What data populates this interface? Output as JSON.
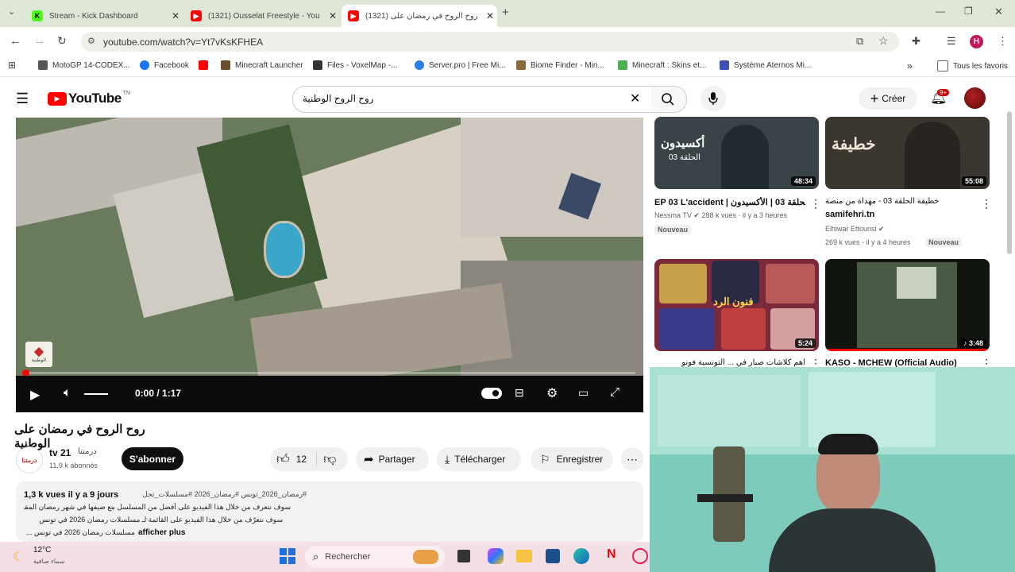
{
  "browser": {
    "tabs": [
      {
        "title": "Stream - Kick Dashboard",
        "favicon": "kick",
        "color": "#53fc18"
      },
      {
        "title": "(1321) Ousselat Freestyle - You",
        "favicon": "youtube",
        "color": "#ff0000"
      },
      {
        "title": "(1321) روح الروح في رمضان على",
        "favicon": "youtube",
        "color": "#ff0000"
      }
    ],
    "url": "youtube.com/watch?v=Yt7vKsKFHEA",
    "profile_initial": "H",
    "bookmarks": [
      "MotoGP 14-CODEX...",
      "Facebook",
      "",
      "Minecraft Launcher",
      "Files - VoxelMap -...",
      "Server.pro | Free Mi...",
      "Biome Finder - Min...",
      "Minecraft : Skins et...",
      "Système Aternos Mi..."
    ],
    "all_bookmarks": "Tous les favoris",
    "more": "»"
  },
  "youtube": {
    "logo": "YouTube",
    "logo_sup": "TN",
    "search_value": "روح الروح الوطنية",
    "create_label": "Créer",
    "notif_count": "9+",
    "player": {
      "time": "0:00 / 1:17",
      "watermark": "الوطنية"
    },
    "video_title": "روح الروح في رمضان على الوطنية",
    "channel": {
      "name": "tv 21",
      "name_ar": "درمتنا",
      "subs": "11,9 k abonnés",
      "avatar_text": "درمتنا"
    },
    "subscribe": "S'abonner",
    "likes": "12",
    "share": "Partager",
    "download": "Télécharger",
    "save": "Enregistrer",
    "description": {
      "stats": "1,3 k vues  il y a 9 jours",
      "hashtags": "#رمضان_2026_تونس #رمضان_2026 #مسلسلات_تجل",
      "line1": "سوف نتعرف من خلال هذا الفيديو على أفضل من المسلسل مع ضيفها في شهر رمضان المقبل",
      "line2": "سوف نتعرّف من خلال هذا الفيديو على القائمة لـ مسلسلات رمضان 2026 في تونس",
      "line3_pre": "مسلسلات رمضان 2026 في تونس ...",
      "more": "afficher plus"
    },
    "recommendations": [
      {
        "title": "EP 03 L'accident | الحلقة 03 | الأكسيدون |",
        "channel": "Nessma TV",
        "views": "288 k vues · il y a 3 heures",
        "badge": "Nouveau",
        "duration": "48:34",
        "overlay": "أكسيدون",
        "overlay2": "الحلقة 03",
        "color": "#3a4448"
      },
      {
        "title": "خطيفة الحلقة 03 - مهداة من منصة",
        "title2": "samifehri.tn",
        "channel": "Elhiwar Ettounsi",
        "views": "269 k vues · il y a 4 heures",
        "badge": "Nouveau",
        "duration": "55:08",
        "overlay": "خطيفة",
        "color": "#3c3630"
      },
      {
        "title": "أهم كلاشات صبار في ... التونسية فونو",
        "duration": "5:24",
        "overlay": "فنون الرد",
        "color": "#7a2a3a"
      },
      {
        "title": "KASO - MCHEW (Official Audio)",
        "duration": "3:48",
        "color": "#1c2a1c"
      }
    ]
  },
  "taskbar": {
    "weather_temp": "12°C",
    "weather_desc": "سماء صافية",
    "search_placeholder": "Rechercher"
  },
  "colors": {
    "youtube_red": "#ff0000",
    "tab_strip": "#dfe8d6",
    "subscribe_bg": "#0f0f0f"
  }
}
